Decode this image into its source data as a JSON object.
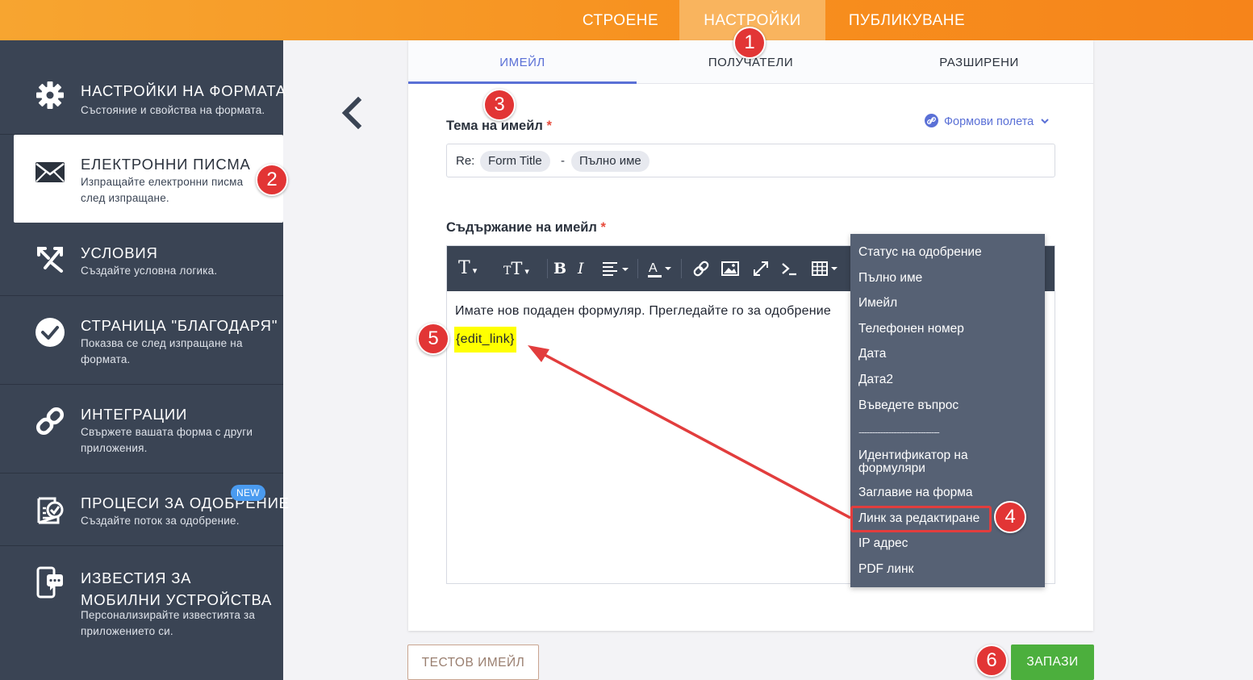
{
  "top_tabs": [
    {
      "label": "СТРОЕНЕ"
    },
    {
      "label": "НАСТРОЙКИ"
    },
    {
      "label": "ПУБЛИКУВАНЕ"
    }
  ],
  "sidebar": {
    "items": [
      {
        "title": "НАСТРОЙКИ НА ФОРМАТА",
        "desc": "Състояние и свойства на формата.",
        "icon": "gear-icon"
      },
      {
        "title": "ЕЛЕКТРОННИ ПИСМА",
        "desc": "Изпращайте електронни писма след изпращане.",
        "icon": "envelope-icon"
      },
      {
        "title": "УСЛОВИЯ",
        "desc": "Създайте условна логика.",
        "icon": "conditions-icon"
      },
      {
        "title": "СТРАНИЦА \"БЛАГОДАРЯ\"",
        "desc": "Показва се след изпращане на формата.",
        "icon": "checkmark-circle-icon"
      },
      {
        "title": "ИНТЕГРАЦИИ",
        "desc": "Свържете вашата форма с други приложения.",
        "icon": "link-icon"
      },
      {
        "title": "ПРОЦЕСИ ЗА ОДОБРЕНИЕ",
        "desc": "Създайте поток за одобрение.",
        "icon": "approval-icon",
        "badge": "NEW"
      },
      {
        "title": "ИЗВЕСТИЯ ЗА МОБИЛНИ УСТРОЙСТВА",
        "desc": "Персонализирайте известията за приложението си.",
        "icon": "mobile-notification-icon"
      }
    ]
  },
  "sub_tabs": [
    {
      "label": "ИМЕЙЛ"
    },
    {
      "label": "ПОЛУЧАТЕЛИ"
    },
    {
      "label": "РАЗШИРЕНИ"
    }
  ],
  "subject": {
    "label": "Тема на имейл",
    "required_mark": "*",
    "fields_link": "Формови полета",
    "prefix": "Re:",
    "pill1": "Form Title",
    "separator": "-",
    "pill2": "Пълно име"
  },
  "body": {
    "label": "Съдържание на имейл",
    "required_mark": "*",
    "text": "Имате нов подаден формуляр. Прегледайте го за одобрение",
    "tag": "{edit_link}"
  },
  "dropdown": {
    "items": [
      "Статус на одобрение",
      "Пълно име",
      "Имейл",
      "Телефонен номер",
      "Дата",
      "Дата2",
      "Въведете въпрос",
      "------------------------------",
      "Идентификатор на формуляри",
      "Заглавие на форма",
      "Линк за редактиране",
      "IP адрес",
      "PDF линк"
    ]
  },
  "buttons": {
    "test_email": "ТЕСТОВ ИМЕЙЛ",
    "save": "ЗАПАЗИ"
  },
  "markers": [
    "1",
    "2",
    "3",
    "4",
    "5",
    "6"
  ],
  "colors": {
    "accent_orange": "#f78f1e",
    "sidebar_bg": "#3a4454",
    "active_tab_blue": "#5a70d6",
    "marker_red": "#e23535",
    "save_green": "#4caf3d",
    "highlight_yellow": "#ffff00"
  }
}
